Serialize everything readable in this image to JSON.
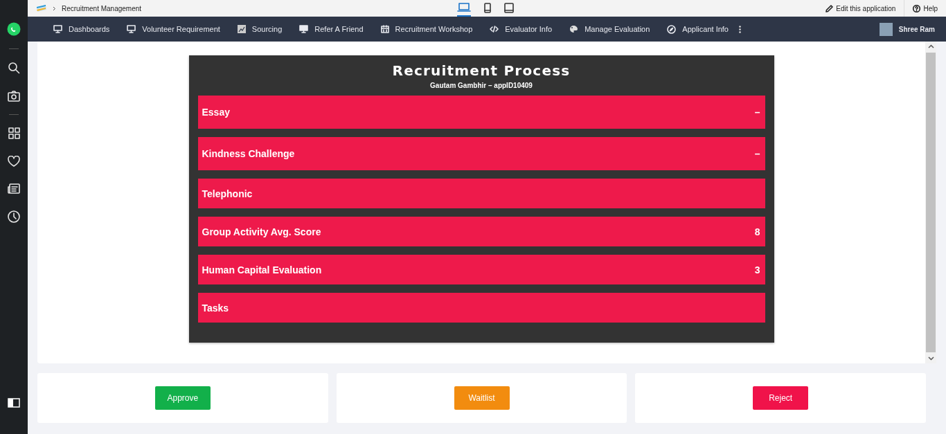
{
  "breadcrumb": {
    "title": "Recruitment Management"
  },
  "devices": [
    {
      "kind": "laptop",
      "selected": true
    },
    {
      "kind": "phone",
      "selected": false
    },
    {
      "kind": "tablet",
      "selected": false
    }
  ],
  "top_links": [
    {
      "kind": "edit",
      "label": "Edit this application"
    },
    {
      "kind": "help",
      "label": "Help"
    }
  ],
  "nav": [
    {
      "kind": "monitor",
      "label": "Dashboards"
    },
    {
      "kind": "monitor",
      "label": "Volunteer Requirement"
    },
    {
      "kind": "chart",
      "label": "Sourcing"
    },
    {
      "kind": "desktop",
      "label": "Refer A Friend"
    },
    {
      "kind": "calendar",
      "label": "Recruitment Workshop"
    },
    {
      "kind": "code",
      "label": "Evaluator Info"
    },
    {
      "kind": "palette",
      "label": "Manage Evaluation"
    },
    {
      "kind": "compass",
      "label": "Applicant Info"
    }
  ],
  "user": {
    "name": "Shree Ram"
  },
  "sidebar_icons": [
    {
      "kind": "whatsapp"
    },
    {
      "kind": "search"
    },
    {
      "kind": "camera"
    },
    {
      "kind": "grid"
    },
    {
      "kind": "heart"
    },
    {
      "kind": "news"
    },
    {
      "kind": "clock"
    }
  ],
  "process": {
    "title": "Recruitment Process",
    "subtitle": "Gautam Gambhir – appID10409",
    "rows": [
      {
        "label": "Essay",
        "value": "–"
      },
      {
        "label": "Kindness Challenge",
        "value": "–"
      },
      {
        "label": "Telephonic"
      },
      {
        "label": "Group Activity Avg. Score",
        "value": "8"
      },
      {
        "label": "Human Capital Evaluation",
        "value": "3"
      },
      {
        "label": "Tasks"
      }
    ]
  },
  "actions": [
    {
      "kind": "approve",
      "label": "Approve"
    },
    {
      "kind": "waitlist",
      "label": "Waitlist"
    },
    {
      "kind": "reject",
      "label": "Reject"
    }
  ]
}
